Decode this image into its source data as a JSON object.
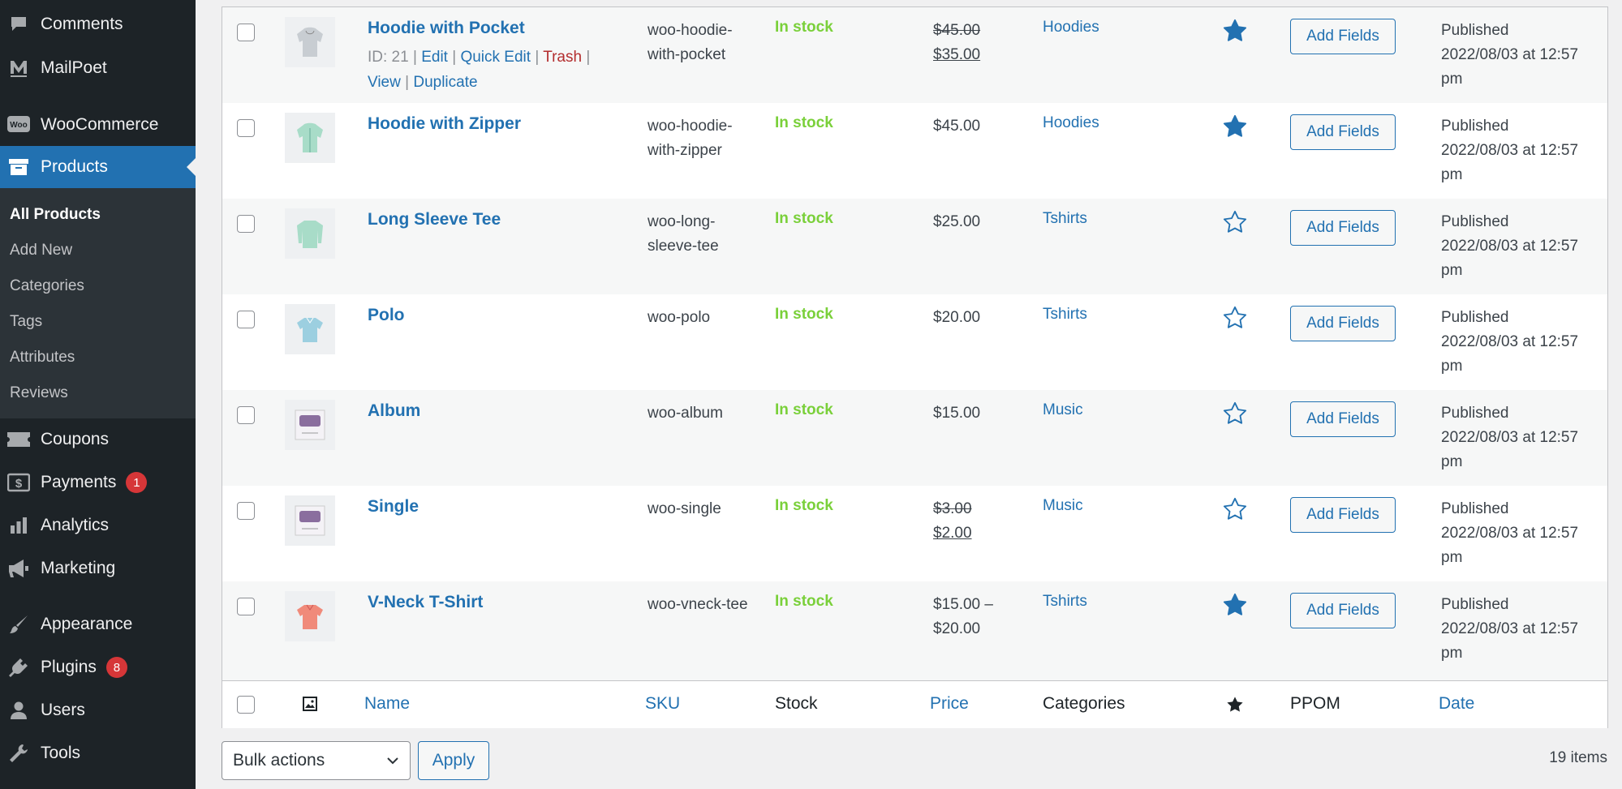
{
  "sidebar": {
    "top": [
      {
        "label": "Comments",
        "icon": "comment-icon"
      },
      {
        "label": "MailPoet",
        "icon": "mailpoet-icon"
      }
    ],
    "woocommerce": {
      "label": "WooCommerce",
      "icon": "woo-icon"
    },
    "products": {
      "label": "Products",
      "icon": "archive-icon"
    },
    "submenu": [
      "All Products",
      "Add New",
      "Categories",
      "Tags",
      "Attributes",
      "Reviews"
    ],
    "lower": [
      {
        "label": "Coupons",
        "icon": "ticket-icon",
        "badge": ""
      },
      {
        "label": "Payments",
        "icon": "dollar-icon",
        "badge": "1"
      },
      {
        "label": "Analytics",
        "icon": "bar-chart-icon",
        "badge": ""
      },
      {
        "label": "Marketing",
        "icon": "megaphone-icon",
        "badge": ""
      }
    ],
    "bottom": [
      {
        "label": "Appearance",
        "icon": "brush-icon",
        "badge": ""
      },
      {
        "label": "Plugins",
        "icon": "plug-icon",
        "badge": "8"
      },
      {
        "label": "Users",
        "icon": "user-icon",
        "badge": ""
      },
      {
        "label": "Tools",
        "icon": "wrench-icon",
        "badge": ""
      }
    ]
  },
  "row_actions": {
    "id": "ID: 21",
    "edit": "Edit",
    "quick_edit": "Quick Edit",
    "trash": "Trash",
    "view": "View",
    "duplicate": "Duplicate",
    "sep": "|"
  },
  "products": [
    {
      "name": "Hoodie with Pocket",
      "sku": "woo-hoodie-with-pocket",
      "stock": "In stock",
      "price_old": "$45.00",
      "price_new": "$35.00",
      "category": "Hoodies",
      "featured": true,
      "action_label": "Add Fields",
      "status": "Published",
      "date": "2022/08/03 at 12:57 pm",
      "thumb_color": "#c8cdd2"
    },
    {
      "name": "Hoodie with Zipper",
      "sku": "woo-hoodie-with-zipper",
      "stock": "In stock",
      "price": "$45.00",
      "category": "Hoodies",
      "featured": true,
      "action_label": "Add Fields",
      "status": "Published",
      "date": "2022/08/03 at 12:57 pm",
      "thumb_color": "#a8dcc8"
    },
    {
      "name": "Long Sleeve Tee",
      "sku": "woo-long-sleeve-tee",
      "stock": "In stock",
      "price": "$25.00",
      "category": "Tshirts",
      "featured": false,
      "action_label": "Add Fields",
      "status": "Published",
      "date": "2022/08/03 at 12:57 pm",
      "thumb_color": "#a8dcc8"
    },
    {
      "name": "Polo",
      "sku": "woo-polo",
      "stock": "In stock",
      "price": "$20.00",
      "category": "Tshirts",
      "featured": false,
      "action_label": "Add Fields",
      "status": "Published",
      "date": "2022/08/03 at 12:57 pm",
      "thumb_color": "#9ccfe0"
    },
    {
      "name": "Album",
      "sku": "woo-album",
      "stock": "In stock",
      "price": "$15.00",
      "category": "Music",
      "featured": false,
      "action_label": "Add Fields",
      "status": "Published",
      "date": "2022/08/03 at 12:57 pm",
      "thumb_color": "#8a6e9e"
    },
    {
      "name": "Single",
      "sku": "woo-single",
      "stock": "In stock",
      "price_old": "$3.00",
      "price_new": "$2.00",
      "category": "Music",
      "featured": false,
      "action_label": "Add Fields",
      "status": "Published",
      "date": "2022/08/03 at 12:57 pm",
      "thumb_color": "#8a6e9e"
    },
    {
      "name": "V-Neck T-Shirt",
      "sku": "woo-vneck-tee",
      "stock": "In stock",
      "price": "$15.00 – $20.00",
      "category": "Tshirts",
      "featured": true,
      "action_label": "Add Fields",
      "status": "Published",
      "date": "2022/08/03 at 12:57 pm",
      "thumb_color": "#f08a7a"
    }
  ],
  "footer_columns": {
    "name": "Name",
    "sku": "SKU",
    "stock": "Stock",
    "price": "Price",
    "categories": "Categories",
    "ppom": "PPOM",
    "date": "Date"
  },
  "bulk": {
    "selected": "Bulk actions",
    "apply": "Apply",
    "count": "19 items"
  },
  "colors": {
    "accent": "#2271b1",
    "stock": "#7ad03a",
    "sidebar": "#1d2327",
    "badge": "#d63638"
  }
}
